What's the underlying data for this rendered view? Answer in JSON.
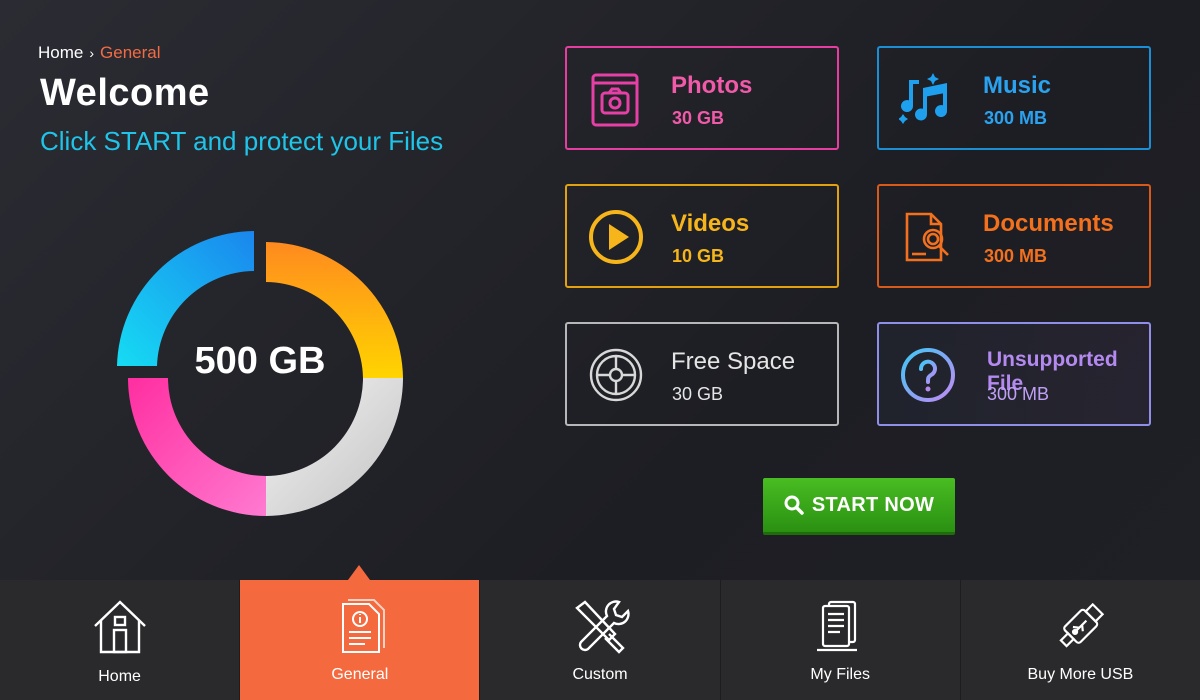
{
  "breadcrumb": {
    "home": "Home",
    "current": "General"
  },
  "header": {
    "title": "Welcome",
    "subtitle": "Click START and protect your Files"
  },
  "storage": {
    "total_label": "500 GB",
    "segments": [
      {
        "name": "orange",
        "color_start": "#ff8a1f",
        "color_end": "#ffd400",
        "fraction": 0.25
      },
      {
        "name": "grey",
        "color_start": "#f2f2f2",
        "color_end": "#c9c9c9",
        "fraction": 0.25
      },
      {
        "name": "pink",
        "color_start": "#ff66cc",
        "color_end": "#ff2e9a",
        "fraction": 0.25
      },
      {
        "name": "blue",
        "color_start": "#0fd2f2",
        "color_end": "#1a8cf0",
        "fraction": 0.25
      }
    ]
  },
  "categories": [
    {
      "id": "photos",
      "name": "Photos",
      "size": "30 GB",
      "icon": "photo-album-icon",
      "color": "#f05aa8"
    },
    {
      "id": "music",
      "name": "Music",
      "size": "300 MB",
      "icon": "music-notes-icon",
      "color": "#2aa2f0"
    },
    {
      "id": "videos",
      "name": "Videos",
      "size": "10 GB",
      "icon": "play-icon",
      "color": "#f7b51c"
    },
    {
      "id": "documents",
      "name": "Documents",
      "size": "300 MB",
      "icon": "document-search-icon",
      "color": "#f2701e"
    },
    {
      "id": "free",
      "name": "Free Space",
      "size": "30 GB",
      "icon": "disk-icon",
      "color": "#e5e5e5"
    },
    {
      "id": "unsupported",
      "name": "Unsupported File",
      "size": "300 MB",
      "icon": "question-icon",
      "color": "#b58af0"
    }
  ],
  "start_button": {
    "label": "START NOW",
    "icon": "search-icon",
    "color": "#3aa81a"
  },
  "nav": {
    "items": [
      {
        "label": "Home",
        "icon": "house-icon",
        "active": false
      },
      {
        "label": "General",
        "icon": "document-info-icon",
        "active": true
      },
      {
        "label": "Custom",
        "icon": "tools-icon",
        "active": false
      },
      {
        "label": "My Files",
        "icon": "files-icon",
        "active": false
      },
      {
        "label": "Buy More USB",
        "icon": "usb-icon",
        "active": false
      }
    ],
    "active_color": "#f46a3e"
  }
}
